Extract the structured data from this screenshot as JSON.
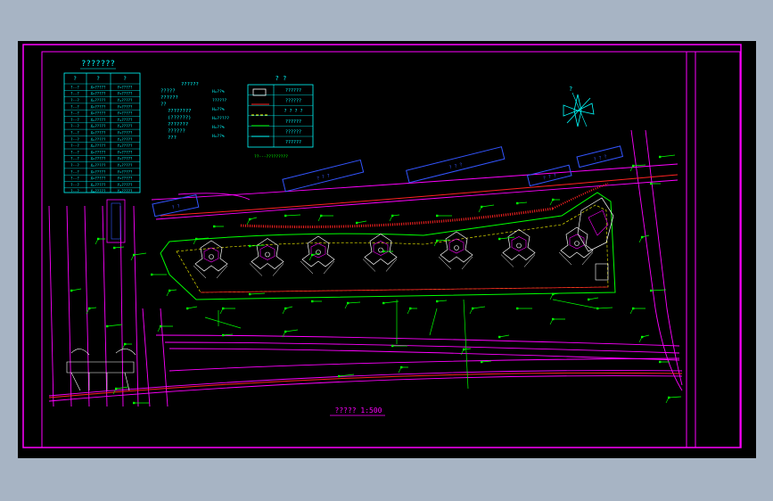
{
  "colors": {
    "background": "#a7b4c4",
    "canvas": "#000000",
    "frame": "#ff00ff",
    "table": "#00ffff",
    "site": "#00ff00",
    "blue": "#3355ff",
    "red": "#ff2222",
    "yellow": "#ffff00",
    "white": "#ffffff"
  },
  "table": {
    "title": "???????",
    "header": [
      "?",
      "?",
      "?"
    ],
    "rows": [
      [
        "?--?",
        "X=?????",
        "Y=?????"
      ],
      [
        "?--?",
        "X=?????",
        "Y=?????"
      ],
      [
        "?--?",
        "X=?????",
        "Y=?????"
      ],
      [
        "?--?",
        "X=?????",
        "Y=?????"
      ],
      [
        "?--?",
        "X=?????",
        "Y=?????"
      ],
      [
        "?--?",
        "X=?????",
        "Y=?????"
      ],
      [
        "?--?",
        "X=?????",
        "Y=?????"
      ],
      [
        "?--?",
        "X=?????",
        "Y=?????"
      ],
      [
        "?--?",
        "X=?????",
        "Y=?????"
      ],
      [
        "?--?",
        "X=?????",
        "Y=?????"
      ],
      [
        "?--?",
        "X=?????",
        "Y=?????"
      ],
      [
        "?--?",
        "X=?????",
        "Y=?????"
      ],
      [
        "?--?",
        "X=?????",
        "Y=?????"
      ],
      [
        "?--?",
        "X=?????",
        "Y=?????"
      ],
      [
        "?--?",
        "X=?????",
        "Y=?????"
      ],
      [
        "?--?",
        "X=?????",
        "Y=?????"
      ],
      [
        "?--?",
        "X=?????",
        "Y=?????"
      ]
    ]
  },
  "notes": {
    "lines": [
      "??????",
      "?????",
      "??????",
      "??",
      "????????",
      "(??????)",
      "???????",
      "??????",
      "???"
    ],
    "values": [
      "H=??%",
      "??????",
      "H=??%",
      "H=?????",
      "H=??%",
      "H=??%"
    ]
  },
  "legend": {
    "title": "?  ?",
    "items": [
      "??????",
      "??????",
      "?  ? ? ?",
      "??????",
      "??????",
      "??????"
    ],
    "footer": "??---?????????"
  },
  "blocks": [
    "?  ?  ?",
    "?  ?  ?",
    "? ? ?",
    "? ? ?",
    "? ?"
  ],
  "drawing_title": "????? 1:500",
  "compass": "?"
}
